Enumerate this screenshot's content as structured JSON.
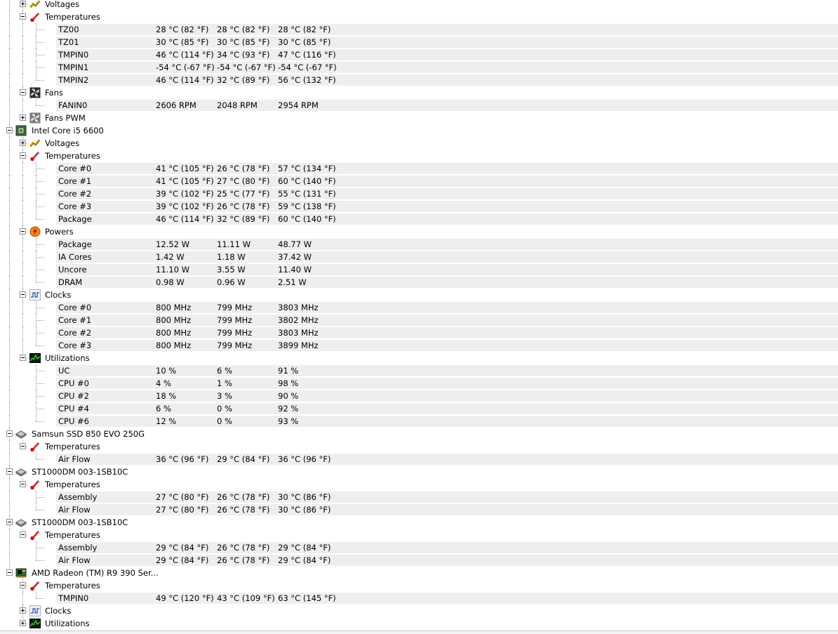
{
  "rows": [
    {
      "level": 1,
      "kind": "group",
      "icon": "voltage-icon",
      "label": "Voltages",
      "expanded": false
    },
    {
      "level": 1,
      "kind": "group",
      "icon": "thermometer-icon",
      "label": "Temperatures",
      "expanded": true
    },
    {
      "level": 2,
      "kind": "sensor",
      "label": "TZ00",
      "values": [
        "28 °C  (82 °F)",
        "28 °C  (82 °F)",
        "28 °C  (82 °F)"
      ]
    },
    {
      "level": 2,
      "kind": "sensor",
      "label": "TZ01",
      "values": [
        "30 °C  (85 °F)",
        "30 °C  (85 °F)",
        "30 °C  (85 °F)"
      ]
    },
    {
      "level": 2,
      "kind": "sensor",
      "label": "TMPIN0",
      "values": [
        "46 °C  (114 °F)",
        "34 °C  (93 °F)",
        "47 °C  (116 °F)"
      ]
    },
    {
      "level": 2,
      "kind": "sensor",
      "label": "TMPIN1",
      "values": [
        "-54 °C  (-67 °F)",
        "-54 °C  (-67 °F)",
        "-54 °C  (-67 °F)"
      ]
    },
    {
      "level": 2,
      "kind": "sensor",
      "label": "TMPIN2",
      "values": [
        "46 °C  (114 °F)",
        "32 °C  (89 °F)",
        "56 °C  (132 °F)"
      ]
    },
    {
      "level": 1,
      "kind": "group",
      "icon": "fan-icon",
      "label": "Fans",
      "expanded": true
    },
    {
      "level": 2,
      "kind": "sensor",
      "label": "FANIN0",
      "values": [
        "2606 RPM",
        "2048 RPM",
        "2954 RPM"
      ]
    },
    {
      "level": 1,
      "kind": "group",
      "icon": "fan-pwm-icon",
      "label": "Fans PWM",
      "expanded": false
    },
    {
      "level": 0,
      "kind": "device",
      "icon": "cpu-chip-icon",
      "label": "Intel Core i5 6600",
      "expanded": true
    },
    {
      "level": 1,
      "kind": "group",
      "icon": "voltage-icon",
      "label": "Voltages",
      "expanded": false
    },
    {
      "level": 1,
      "kind": "group",
      "icon": "thermometer-icon",
      "label": "Temperatures",
      "expanded": true
    },
    {
      "level": 2,
      "kind": "sensor",
      "label": "Core #0",
      "values": [
        "41 °C  (105 °F)",
        "26 °C  (78 °F)",
        "57 °C  (134 °F)"
      ]
    },
    {
      "level": 2,
      "kind": "sensor",
      "label": "Core #1",
      "values": [
        "41 °C  (105 °F)",
        "27 °C  (80 °F)",
        "60 °C  (140 °F)"
      ]
    },
    {
      "level": 2,
      "kind": "sensor",
      "label": "Core #2",
      "values": [
        "39 °C  (102 °F)",
        "25 °C  (77 °F)",
        "55 °C  (131 °F)"
      ]
    },
    {
      "level": 2,
      "kind": "sensor",
      "label": "Core #3",
      "values": [
        "39 °C  (102 °F)",
        "26 °C  (78 °F)",
        "59 °C  (138 °F)"
      ]
    },
    {
      "level": 2,
      "kind": "sensor",
      "label": "Package",
      "values": [
        "46 °C  (114 °F)",
        "32 °C  (89 °F)",
        "60 °C  (140 °F)"
      ]
    },
    {
      "level": 1,
      "kind": "group",
      "icon": "power-icon",
      "label": "Powers",
      "expanded": true
    },
    {
      "level": 2,
      "kind": "sensor",
      "label": "Package",
      "values": [
        "12.52 W",
        "11.11 W",
        "48.77 W"
      ]
    },
    {
      "level": 2,
      "kind": "sensor",
      "label": "IA Cores",
      "values": [
        "1.42 W",
        "1.18 W",
        "37.42 W"
      ]
    },
    {
      "level": 2,
      "kind": "sensor",
      "label": "Uncore",
      "values": [
        "11.10 W",
        "3.55 W",
        "11.40 W"
      ]
    },
    {
      "level": 2,
      "kind": "sensor",
      "label": "DRAM",
      "values": [
        "0.98 W",
        "0.96 W",
        "2.51 W"
      ]
    },
    {
      "level": 1,
      "kind": "group",
      "icon": "clock-icon",
      "label": "Clocks",
      "expanded": true
    },
    {
      "level": 2,
      "kind": "sensor",
      "label": "Core #0",
      "values": [
        "800 MHz",
        "799 MHz",
        "3803 MHz"
      ]
    },
    {
      "level": 2,
      "kind": "sensor",
      "label": "Core #1",
      "values": [
        "800 MHz",
        "799 MHz",
        "3802 MHz"
      ]
    },
    {
      "level": 2,
      "kind": "sensor",
      "label": "Core #2",
      "values": [
        "800 MHz",
        "799 MHz",
        "3803 MHz"
      ]
    },
    {
      "level": 2,
      "kind": "sensor",
      "label": "Core #3",
      "values": [
        "800 MHz",
        "799 MHz",
        "3899 MHz"
      ]
    },
    {
      "level": 1,
      "kind": "group",
      "icon": "utilization-icon",
      "label": "Utilizations",
      "expanded": true
    },
    {
      "level": 2,
      "kind": "sensor",
      "label": "UC",
      "values": [
        "10 %",
        "6 %",
        "91 %"
      ]
    },
    {
      "level": 2,
      "kind": "sensor",
      "label": "CPU #0",
      "values": [
        "4 %",
        "1 %",
        "98 %"
      ]
    },
    {
      "level": 2,
      "kind": "sensor",
      "label": "CPU #2",
      "values": [
        "18 %",
        "3 %",
        "90 %"
      ]
    },
    {
      "level": 2,
      "kind": "sensor",
      "label": "CPU #4",
      "values": [
        "6 %",
        "0 %",
        "92 %"
      ]
    },
    {
      "level": 2,
      "kind": "sensor",
      "label": "CPU #6",
      "values": [
        "12 %",
        "0 %",
        "93 %"
      ]
    },
    {
      "level": 0,
      "kind": "device",
      "icon": "disk-drive-icon",
      "label": "Samsun SSD 850 EVO 250G",
      "expanded": true
    },
    {
      "level": 1,
      "kind": "group",
      "icon": "thermometer-icon",
      "label": "Temperatures",
      "expanded": true
    },
    {
      "level": 2,
      "kind": "sensor",
      "label": "Air Flow",
      "values": [
        "36 °C  (96 °F)",
        "29 °C  (84 °F)",
        "36 °C  (96 °F)"
      ]
    },
    {
      "level": 0,
      "kind": "device",
      "icon": "disk-drive-icon",
      "label": "ST1000DM 003-1SB10C",
      "expanded": true
    },
    {
      "level": 1,
      "kind": "group",
      "icon": "thermometer-icon",
      "label": "Temperatures",
      "expanded": true
    },
    {
      "level": 2,
      "kind": "sensor",
      "label": "Assembly",
      "values": [
        "27 °C  (80 °F)",
        "26 °C  (78 °F)",
        "30 °C  (86 °F)"
      ]
    },
    {
      "level": 2,
      "kind": "sensor",
      "label": "Air Flow",
      "values": [
        "27 °C  (80 °F)",
        "26 °C  (78 °F)",
        "30 °C  (86 °F)"
      ]
    },
    {
      "level": 0,
      "kind": "device",
      "icon": "disk-drive-icon",
      "label": "ST1000DM 003-1SB10C",
      "expanded": true
    },
    {
      "level": 1,
      "kind": "group",
      "icon": "thermometer-icon",
      "label": "Temperatures",
      "expanded": true
    },
    {
      "level": 2,
      "kind": "sensor",
      "label": "Assembly",
      "values": [
        "29 °C  (84 °F)",
        "26 °C  (78 °F)",
        "29 °C  (84 °F)"
      ]
    },
    {
      "level": 2,
      "kind": "sensor",
      "label": "Air Flow",
      "values": [
        "29 °C  (84 °F)",
        "26 °C  (78 °F)",
        "29 °C  (84 °F)"
      ]
    },
    {
      "level": 0,
      "kind": "device",
      "icon": "gpu-card-icon",
      "label": "AMD Radeon (TM) R9 390 Ser...",
      "expanded": true
    },
    {
      "level": 1,
      "kind": "group",
      "icon": "thermometer-icon",
      "label": "Temperatures",
      "expanded": true
    },
    {
      "level": 2,
      "kind": "sensor",
      "label": "TMPIN0",
      "values": [
        "49 °C  (120 °F)",
        "43 °C  (109 °F)",
        "63 °C  (145 °F)"
      ]
    },
    {
      "level": 1,
      "kind": "group",
      "icon": "clock-icon",
      "label": "Clocks",
      "expanded": false
    },
    {
      "level": 1,
      "kind": "group",
      "icon": "utilization-icon",
      "label": "Utilizations",
      "expanded": false
    }
  ],
  "colors": {
    "row_shade": "#eeeeee",
    "tree_lines": "#9a9a9a",
    "text": "#000000"
  }
}
